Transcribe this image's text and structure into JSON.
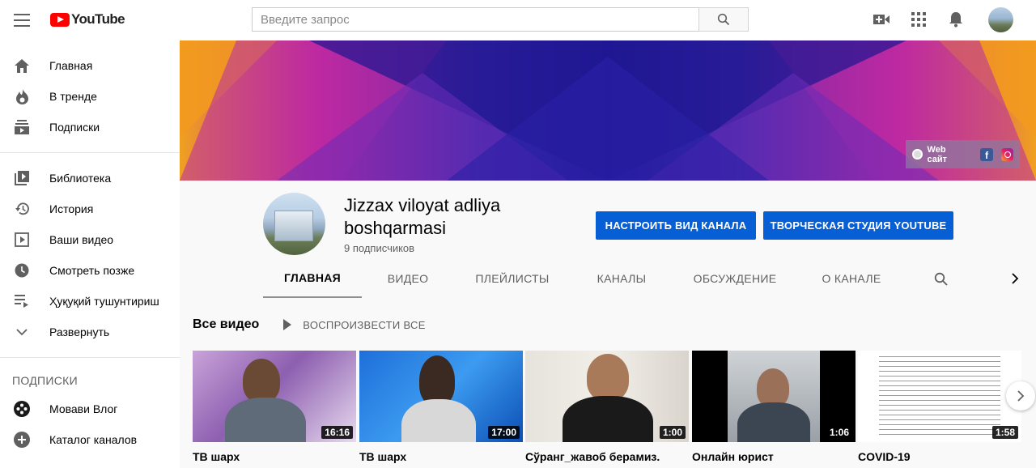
{
  "header": {
    "logo_text": "YouTube",
    "search_placeholder": "Введите запрос"
  },
  "sidebar": {
    "items": [
      {
        "label": "Главная",
        "icon": "home-icon"
      },
      {
        "label": "В тренде",
        "icon": "fire-icon"
      },
      {
        "label": "Подписки",
        "icon": "subscriptions-icon"
      },
      {
        "label": "Библиотека",
        "icon": "library-icon"
      },
      {
        "label": "История",
        "icon": "history-icon"
      },
      {
        "label": "Ваши видео",
        "icon": "your-videos-icon"
      },
      {
        "label": "Смотреть позже",
        "icon": "watch-later-icon"
      },
      {
        "label": "Ҳуқуқий тушунтириш",
        "icon": "playlist-icon"
      },
      {
        "label": "Развернуть",
        "icon": "chevron-down-icon"
      }
    ],
    "subscriptions_heading": "ПОДПИСКИ",
    "subscriptions": [
      {
        "label": "Мовави Влог",
        "icon": "movavi-avatar"
      },
      {
        "label": "Каталог каналов",
        "icon": "add-circle-icon"
      }
    ]
  },
  "banner": {
    "web_label": "Web сайт",
    "facebook_letter": "f"
  },
  "channel": {
    "name": "Jizzax viloyat adliya boshqarmasi",
    "subscribers": "9 подписчиков",
    "customize_button": "НАСТРОИТЬ ВИД КАНАЛА",
    "studio_button": "ТВОРЧЕСКАЯ СТУДИЯ YOUTUBE",
    "tabs": [
      "ГЛАВНАЯ",
      "ВИДЕО",
      "ПЛЕЙЛИСТЫ",
      "КАНАЛЫ",
      "ОБСУЖДЕНИЕ",
      "О КАНАЛЕ"
    ],
    "active_tab": "ГЛАВНАЯ"
  },
  "videos_section": {
    "title": "Все видео",
    "play_all": "ВОСПРОИЗВЕСТИ ВСЕ",
    "videos": [
      {
        "title": "ТВ шарх",
        "duration": "16:16"
      },
      {
        "title": "ТВ шарх",
        "duration": "17:00"
      },
      {
        "title": "Сўранг_жавоб берамиз.",
        "duration": "1:00"
      },
      {
        "title": "Онлайн юрист",
        "duration": "1:06"
      },
      {
        "title": "COVID-19",
        "duration": "1:58"
      }
    ]
  },
  "colors": {
    "accent_blue": "#065fd4",
    "youtube_red": "#ff0000"
  }
}
